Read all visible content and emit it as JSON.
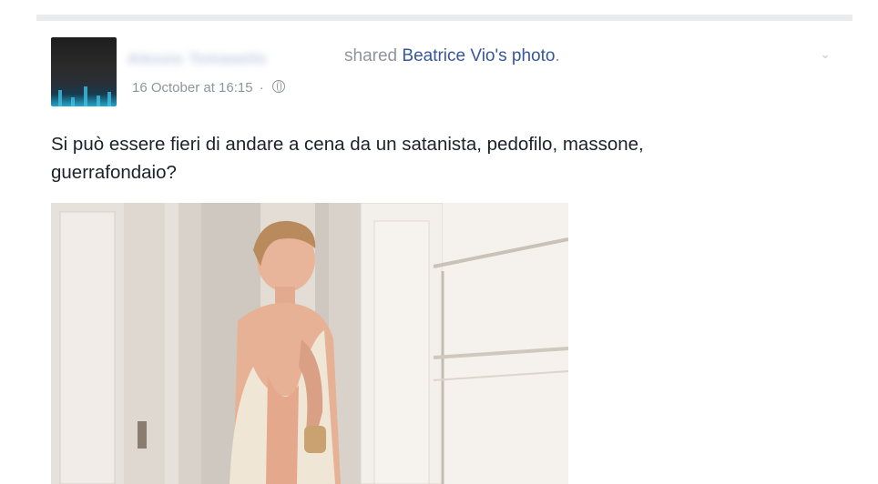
{
  "post": {
    "author_blurred": "Alessio Tomasello",
    "shared_text": "shared",
    "shared_link": "Beatrice Vio's photo",
    "shared_tail": ".",
    "timestamp": "16 October at 16:15",
    "separator": "·",
    "audience_icon": "globe-icon",
    "text_line1": "Si può essere fieri di andare a cena da un satanista, pedofilo, massone,",
    "text_line2": "guerrafondaio?",
    "options_icon": "chevron-down-icon"
  },
  "colors": {
    "link": "#365899",
    "meta": "#90949c",
    "body_text": "#1d2129",
    "divider": "#e9ebee"
  }
}
